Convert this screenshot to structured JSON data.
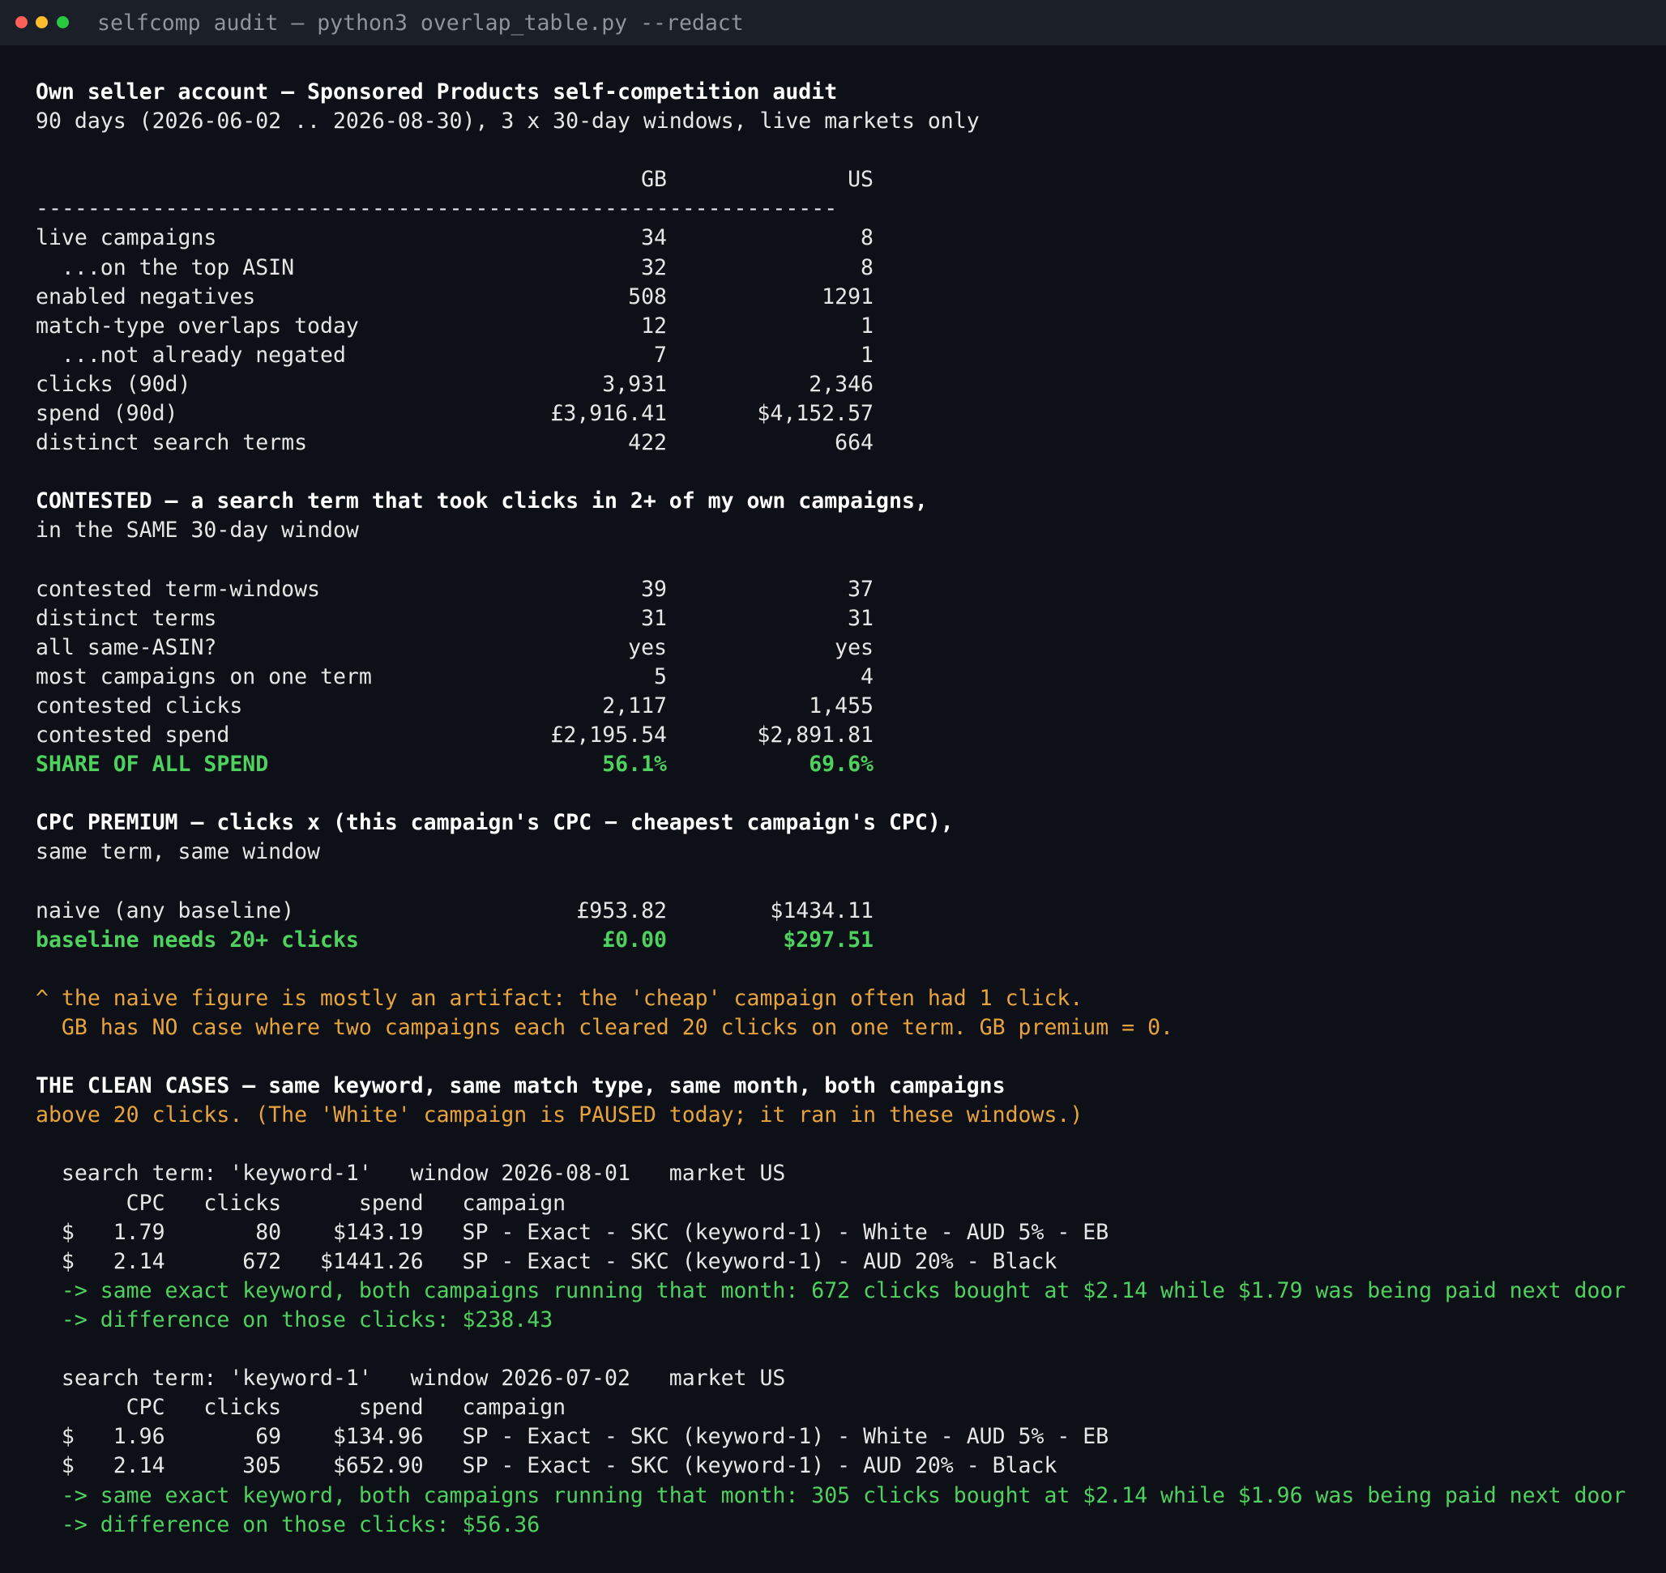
{
  "window": {
    "title": "selfcomp audit — python3 overlap_table.py --redact"
  },
  "header": {
    "line1": "Own seller account — Sponsored Products self-competition audit",
    "line2": "90 days (2026-06-02 .. 2026-08-30), 3 x 30-day windows, live markets only"
  },
  "columns": {
    "gb": "GB",
    "us": "US"
  },
  "separator": "--------------------------------------------------------------",
  "summary_rows": [
    {
      "label": "live campaigns",
      "gb": "34",
      "us": "8"
    },
    {
      "label": "  ...on the top ASIN",
      "gb": "32",
      "us": "8"
    },
    {
      "label": "enabled negatives",
      "gb": "508",
      "us": "1291"
    },
    {
      "label": "match-type overlaps today",
      "gb": "12",
      "us": "1"
    },
    {
      "label": "  ...not already negated",
      "gb": "7",
      "us": "1"
    },
    {
      "label": "clicks (90d)",
      "gb": "3,931",
      "us": "2,346"
    },
    {
      "label": "spend (90d)",
      "gb": "£3,916.41",
      "us": "$4,152.57"
    },
    {
      "label": "distinct search terms",
      "gb": "422",
      "us": "664"
    }
  ],
  "contested": {
    "heading1": "CONTESTED — a search term that took clicks in 2+ of my own campaigns,",
    "heading2": "in the SAME 30-day window",
    "rows": [
      {
        "label": "contested term-windows",
        "gb": "39",
        "us": "37"
      },
      {
        "label": "distinct terms",
        "gb": "31",
        "us": "31"
      },
      {
        "label": "all same-ASIN?",
        "gb": "yes",
        "us": "yes"
      },
      {
        "label": "most campaigns on one term",
        "gb": "5",
        "us": "4"
      },
      {
        "label": "contested clicks",
        "gb": "2,117",
        "us": "1,455"
      },
      {
        "label": "contested spend",
        "gb": "£2,195.54",
        "us": "$2,891.81"
      }
    ],
    "share": {
      "label": "SHARE OF ALL SPEND",
      "gb": "56.1%",
      "us": "69.6%"
    }
  },
  "premium": {
    "heading1": "CPC PREMIUM — clicks x (this campaign's CPC − cheapest campaign's CPC),",
    "heading2": "same term, same window",
    "naive": {
      "label": "naive (any baseline)",
      "gb": "£953.82",
      "us": "$1434.11"
    },
    "baseline": {
      "label": "baseline needs 20+ clicks",
      "gb": "£0.00",
      "us": "$297.51"
    }
  },
  "note": {
    "line1": "^ the naive figure is mostly an artifact: the 'cheap' campaign often had 1 click.",
    "line2": "  GB has NO case where two campaigns each cleared 20 clicks on one term. GB premium = 0."
  },
  "clean": {
    "heading1": "THE CLEAN CASES — same keyword, same match type, same month, both campaigns",
    "heading2": "above 20 clicks. (The 'White' campaign is PAUSED today; it ran in these windows.)",
    "cases": [
      {
        "header": "  search term: 'keyword-1'   window 2026-08-01   market US",
        "cols": "       CPC   clicks      spend   campaign",
        "rows": [
          "  $   1.79       80    $143.19   SP - Exact - SKC (keyword-1) - White - AUD 5% - EB",
          "  $   2.14      672   $1441.26   SP - Exact - SKC (keyword-1) - AUD 20% - Black"
        ],
        "arrow1": "  -> same exact keyword, both campaigns running that month: 672 clicks bought at $2.14 while $1.79 was being paid next door",
        "arrow2": "  -> difference on those clicks: $238.43"
      },
      {
        "header": "  search term: 'keyword-1'   window 2026-07-02   market US",
        "cols": "       CPC   clicks      spend   campaign",
        "rows": [
          "  $   1.96       69    $134.96   SP - Exact - SKC (keyword-1) - White - AUD 5% - EB",
          "  $   2.14      305    $652.90   SP - Exact - SKC (keyword-1) - AUD 20% - Black"
        ],
        "arrow1": "  -> same exact keyword, both campaigns running that month: 305 clicks bought at $2.14 while $1.96 was being paid next door",
        "arrow2": "  -> difference on those clicks: $56.36"
      }
    ]
  }
}
